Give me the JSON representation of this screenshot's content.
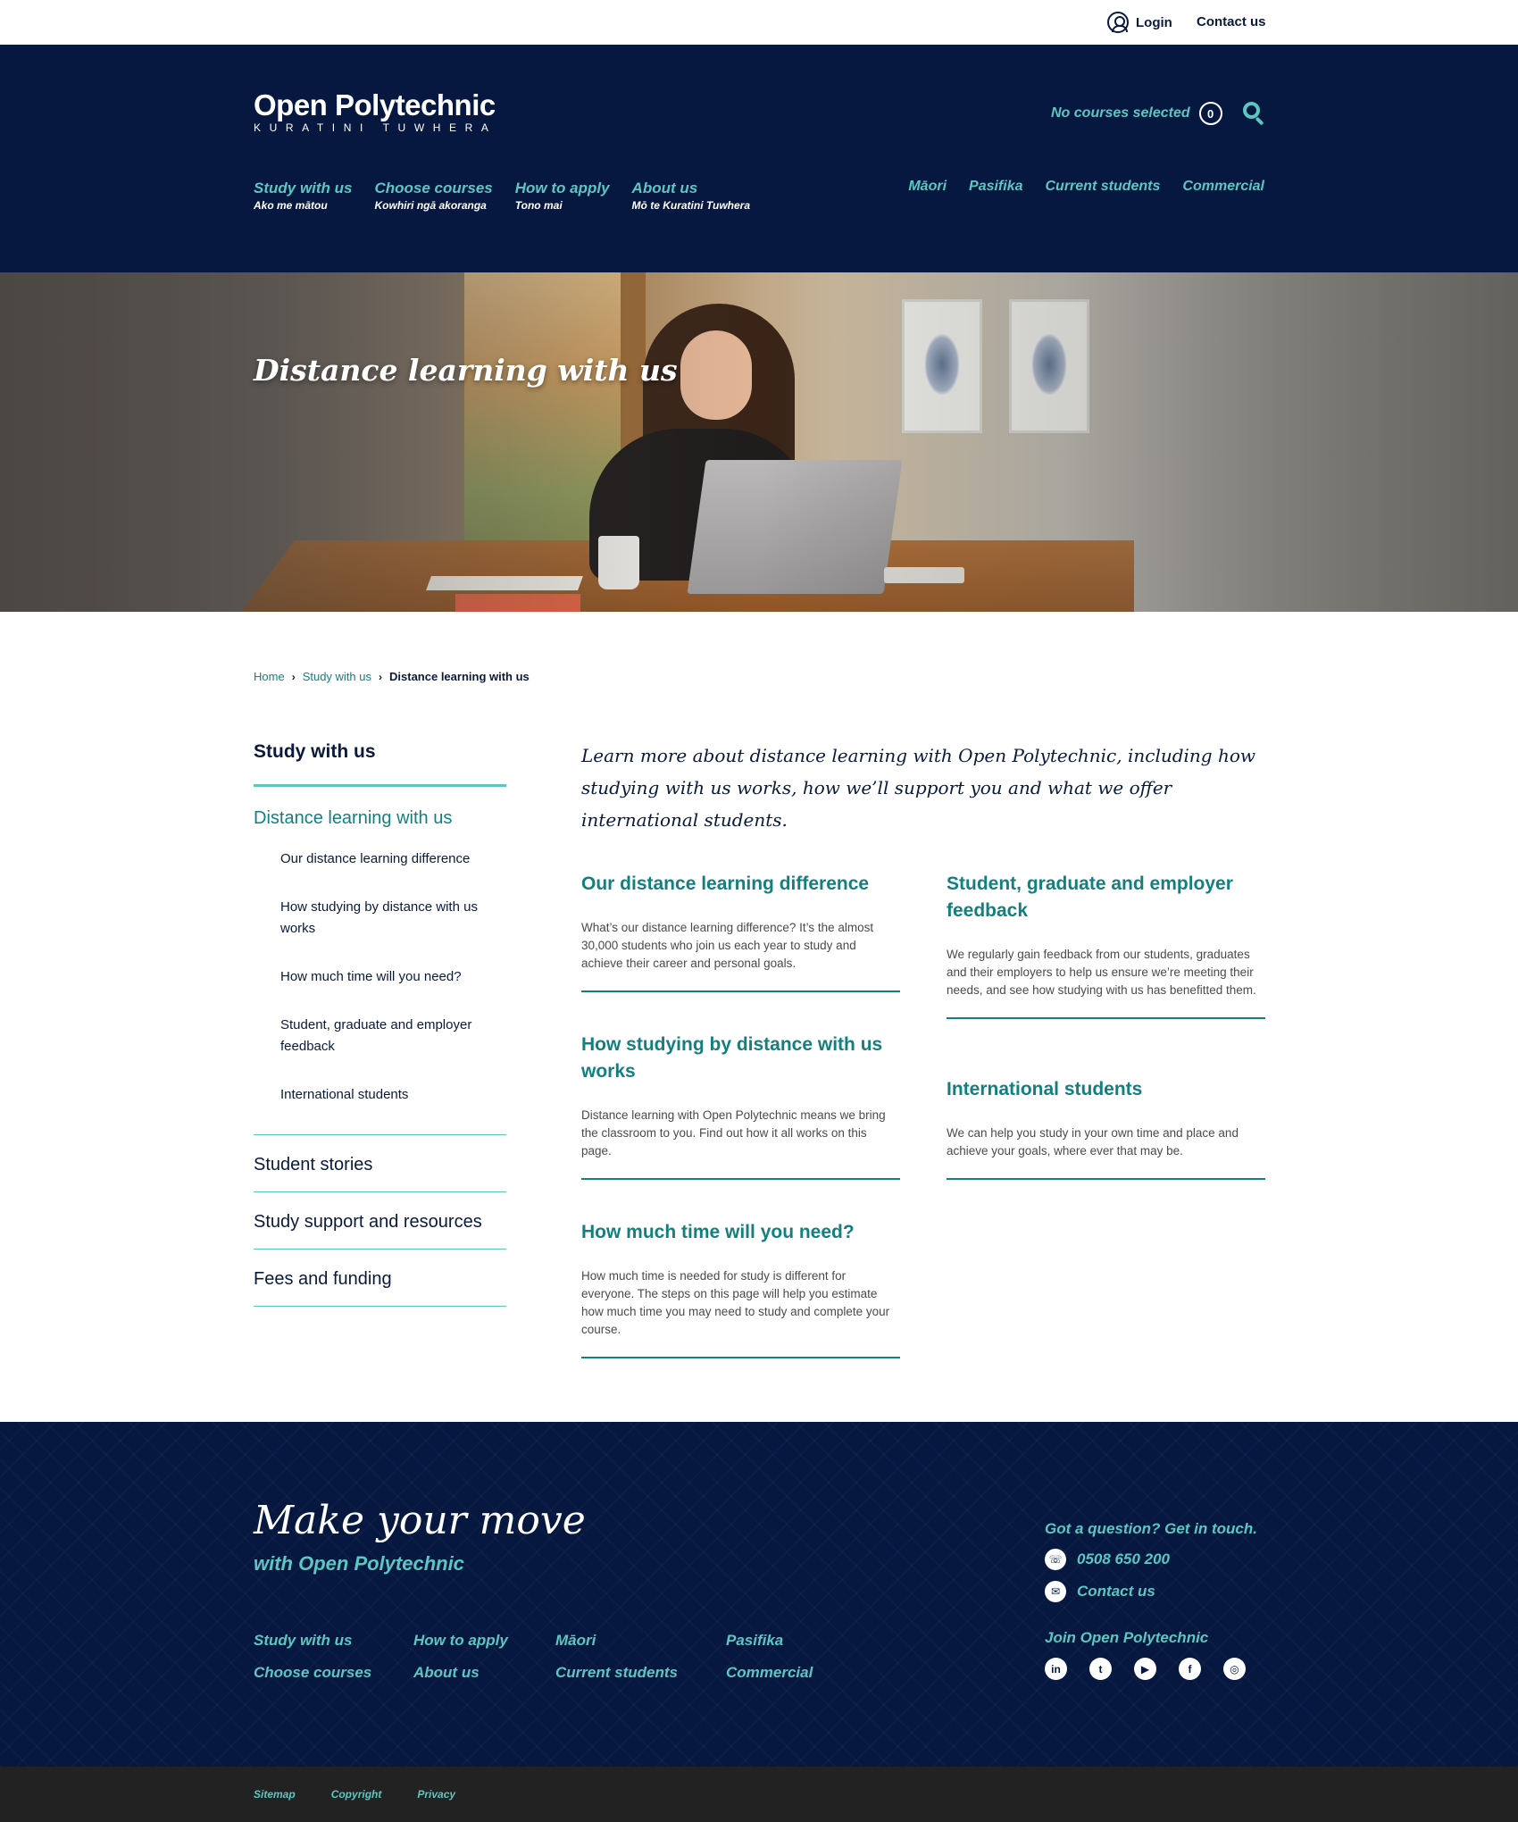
{
  "utility": {
    "login": "Login",
    "contact": "Contact us"
  },
  "header": {
    "logo_main": "Open Polytechnic",
    "logo_sub": "KURATINI TUWHERA",
    "courses_status": "No courses selected",
    "courses_count": "0",
    "main_nav": [
      {
        "label": "Study with us",
        "sub": "Ako me mātou"
      },
      {
        "label": "Choose courses",
        "sub": "Kowhiri ngā akoranga"
      },
      {
        "label": "How to apply",
        "sub": "Tono mai"
      },
      {
        "label": "About us",
        "sub": "Mō te Kuratini Tuwhera"
      }
    ],
    "secondary_nav": [
      "Māori",
      "Pasifika",
      "Current students",
      "Commercial"
    ]
  },
  "hero": {
    "title": "Distance learning with us"
  },
  "breadcrumb": {
    "items": [
      "Home",
      "Study with us"
    ],
    "current": "Distance learning with us",
    "separator": "›"
  },
  "sidebar": {
    "heading": "Study with us",
    "active": "Distance learning with us",
    "sub_items": [
      "Our distance learning difference",
      "How studying by distance with us works",
      "How much time will you need?",
      "Student, graduate and employer feedback",
      "International students"
    ],
    "top_items": [
      "Student stories",
      "Study support and resources",
      "Fees and funding"
    ]
  },
  "main": {
    "intro": "Learn more about distance learning with Open Polytechnic, including how studying with us works, how we’ll support you and what we offer international students.",
    "cards": [
      {
        "title": "Our distance learning difference",
        "body": "What’s our distance learning difference? It’s the almost 30,000 students who join us each year to study and achieve their career and personal goals."
      },
      {
        "title": "How studying by distance with us works",
        "body": "Distance learning with Open Polytechnic means we bring the classroom to you. Find out how it all works on this page."
      },
      {
        "title": "How much time will you need?",
        "body": "How much time is needed for study is different for everyone. The steps on this page will help you estimate how much time you may need to study and complete your course."
      },
      {
        "title": "Student, graduate and employer feedback",
        "body": "We regularly gain feedback from our students, graduates and their employers to help us ensure we’re meeting their needs, and see how studying with us has benefitted them."
      },
      {
        "title": "International students",
        "body": "We can help you study in your own time and place and achieve your goals, where ever that may be."
      }
    ]
  },
  "footer": {
    "tagline": "Make your move",
    "subtag": "with Open Polytechnic",
    "links": [
      "Study with us",
      "How to apply",
      "Māori",
      "Pasifika",
      "Choose courses",
      "About us",
      "Current students",
      "Commercial"
    ],
    "contact_heading": "Got a question? Get in touch.",
    "phone": "0508 650 200",
    "contact_link": "Contact us",
    "join_heading": "Join Open Polytechnic",
    "social": [
      {
        "icon": "linkedin-icon",
        "glyph": "in"
      },
      {
        "icon": "twitter-icon",
        "glyph": "t"
      },
      {
        "icon": "youtube-icon",
        "glyph": "▶"
      },
      {
        "icon": "facebook-icon",
        "glyph": "f"
      },
      {
        "icon": "instagram-icon",
        "glyph": "◎"
      }
    ],
    "phone_glyph": "☏",
    "mail_glyph": "✉"
  },
  "legal": {
    "links": [
      "Sitemap",
      "Copyright",
      "Privacy"
    ]
  },
  "colors": {
    "navy": "#06183f",
    "teal": "#5cc6c2",
    "dark_teal": "#13807f",
    "legal_bg": "#222222"
  }
}
